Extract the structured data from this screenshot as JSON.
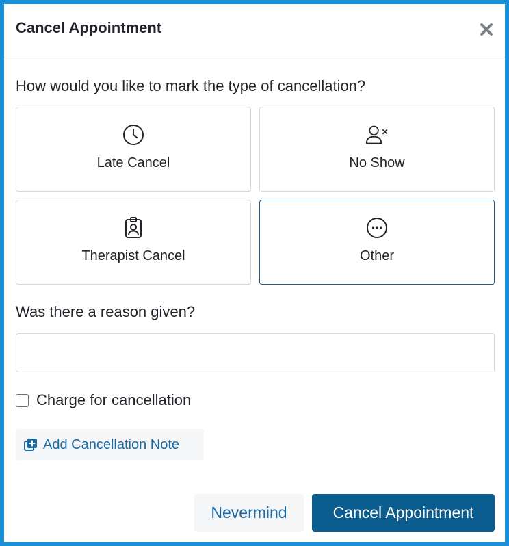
{
  "modal": {
    "title": "Cancel Appointment",
    "close_icon": "close-icon"
  },
  "cancellation_type": {
    "question": "How would you like to mark the type of cancellation?",
    "selected": "Other",
    "options": [
      {
        "label": "Late Cancel",
        "icon": "clock-icon"
      },
      {
        "label": "No Show",
        "icon": "user-x-icon"
      },
      {
        "label": "Therapist Cancel",
        "icon": "badge-icon"
      },
      {
        "label": "Other",
        "icon": "ellipsis-circle-icon"
      }
    ]
  },
  "reason": {
    "label": "Was there a reason given?",
    "value": "",
    "placeholder": ""
  },
  "charge": {
    "label": "Charge for cancellation",
    "checked": false
  },
  "add_note": {
    "label": "Add Cancellation Note",
    "icon": "add-note-icon"
  },
  "footer": {
    "nevermind_label": "Nevermind",
    "confirm_label": "Cancel Appointment"
  },
  "colors": {
    "primary": "#0b5d8f",
    "link": "#1a6aa3",
    "selected_border": "#1e5c87",
    "frame": "#1a8fd6"
  }
}
